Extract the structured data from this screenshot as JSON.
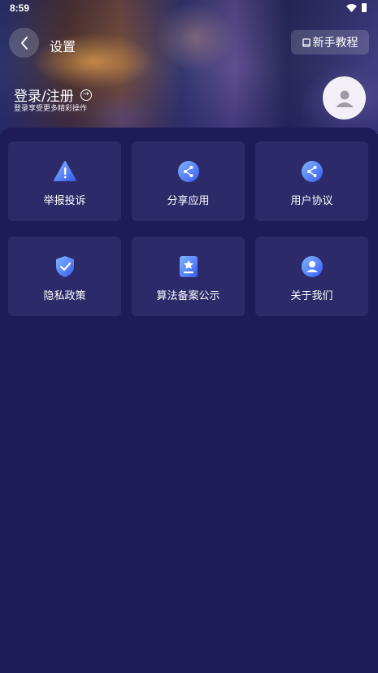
{
  "status": {
    "time": "8:59"
  },
  "header": {
    "title": "设置",
    "tutorial": "新手教程"
  },
  "login": {
    "title": "登录/注册",
    "subtitle": "登录享受更多精彩操作"
  },
  "menu": [
    {
      "label": "举报投诉",
      "icon": "warning-icon"
    },
    {
      "label": "分享应用",
      "icon": "share-icon"
    },
    {
      "label": "用户协议",
      "icon": "share-icon"
    },
    {
      "label": "隐私政策",
      "icon": "shield-check-icon"
    },
    {
      "label": "算法备案公示",
      "icon": "document-star-icon"
    },
    {
      "label": "关于我们",
      "icon": "user-circle-icon"
    }
  ]
}
